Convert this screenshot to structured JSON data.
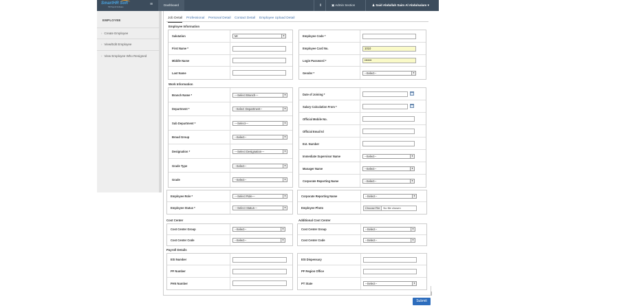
{
  "header": {
    "logo_text": "SmartHR Soft",
    "logo_sub": "HR Payroll Software",
    "dashboard_label": "Dashboard",
    "admin_label": "Admin Section",
    "user_label": "Said Abdullah Saim Al Abdulsalam",
    "colors": {
      "bar": "#3c4c5c",
      "link": "#3e6ea8",
      "submit": "#2d6dbd"
    }
  },
  "sidebar": {
    "title": "EMPLOYEE",
    "items": [
      {
        "label": "Create Employee"
      },
      {
        "label": "View/Edit Employee"
      },
      {
        "label": "View Employee Who Resigned"
      }
    ]
  },
  "tabs": [
    {
      "label": "Job Detail",
      "active": true
    },
    {
      "label": "Professional"
    },
    {
      "label": "Personal Detail"
    },
    {
      "label": "Contact Detail"
    },
    {
      "label": "Employee Upload Detail"
    }
  ],
  "sections": {
    "employee_info": "Employee Information",
    "work_info": "Work Information",
    "cost_center": "Cost Center",
    "additional_cost_center": "Additional Cost Center",
    "payroll": "Payroll Details"
  },
  "emp_left": [
    {
      "label": "Salutation",
      "type": "select",
      "value": "Mr"
    },
    {
      "label": "First Name *",
      "type": "input",
      "value": ""
    },
    {
      "label": "Middle Name",
      "type": "input",
      "value": ""
    },
    {
      "label": "Last Name",
      "type": "input",
      "value": ""
    }
  ],
  "emp_right": [
    {
      "label": "Employee Code *",
      "type": "input",
      "value": ""
    },
    {
      "label": "Employee Card No.",
      "type": "input",
      "value": "1010",
      "highlight": true
    },
    {
      "label": "Login Password *",
      "type": "input",
      "value": "•••••••",
      "highlight": true
    },
    {
      "label": "Gender *",
      "type": "select",
      "value": "--Select--"
    }
  ],
  "work_left": [
    {
      "label": "Branch Name *",
      "type": "select",
      "value": "---Select Branch---"
    },
    {
      "label": "Department *",
      "type": "select",
      "value": "--Select Department--"
    },
    {
      "label": "Sub Department *",
      "type": "select",
      "value": "---Select---"
    },
    {
      "label": "Broad Group",
      "type": "select",
      "value": "--Select--"
    },
    {
      "label": "Designation *",
      "type": "select",
      "value": "---Select Designation---"
    },
    {
      "label": "Grade Type",
      "type": "select",
      "value": "--Select--"
    },
    {
      "label": "Grade",
      "type": "select",
      "value": "--Select--"
    }
  ],
  "work_right": [
    {
      "label": "Date of Joining *",
      "type": "date",
      "value": ""
    },
    {
      "label": "Salary Calculation From *",
      "type": "date",
      "value": ""
    },
    {
      "label": "Official Mobile No.",
      "type": "input",
      "value": ""
    },
    {
      "label": "Official Email Id",
      "type": "input",
      "value": ""
    },
    {
      "label": "Ext. Number",
      "type": "input",
      "value": ""
    },
    {
      "label": "Immediate Supervisor Name",
      "type": "select",
      "value": "--Select--"
    },
    {
      "label": "Manager Name",
      "type": "select",
      "value": "--Select--"
    },
    {
      "label": "Corporate Reporting Name",
      "type": "select",
      "value": "--Select--"
    }
  ],
  "role_left": [
    {
      "label": "Employee Role *",
      "type": "select",
      "value": "---Select Role---"
    },
    {
      "label": "Employee Status *",
      "type": "select",
      "value": "---Select Status---"
    }
  ],
  "role_right": [
    {
      "label": "Corporate Reporting Name",
      "type": "select",
      "value": "--Select--"
    },
    {
      "label": "Employee Photo",
      "type": "file",
      "button": "Choose File",
      "value": "No file chosen"
    }
  ],
  "cost_left": [
    {
      "label": "Cost Center Group",
      "type": "select",
      "value": "--Select--"
    },
    {
      "label": "Cost Center Code",
      "type": "select",
      "value": "--Select--"
    }
  ],
  "cost_right": [
    {
      "label": "Cost Center Group",
      "type": "select",
      "value": "--Select--"
    },
    {
      "label": "Cost Center Code",
      "type": "select",
      "value": "--Select--"
    }
  ],
  "pay_left": [
    {
      "label": "ESI Number",
      "type": "input",
      "value": ""
    },
    {
      "label": "PF Number",
      "type": "input",
      "value": ""
    },
    {
      "label": "PAN Number",
      "type": "input",
      "value": ""
    }
  ],
  "pay_right": [
    {
      "label": "ESI Dispensary",
      "type": "input",
      "value": ""
    },
    {
      "label": "PF Region Office",
      "type": "input",
      "value": ""
    },
    {
      "label": "PT State",
      "type": "select",
      "value": "--Select--"
    }
  ],
  "submit_label": "Submit"
}
